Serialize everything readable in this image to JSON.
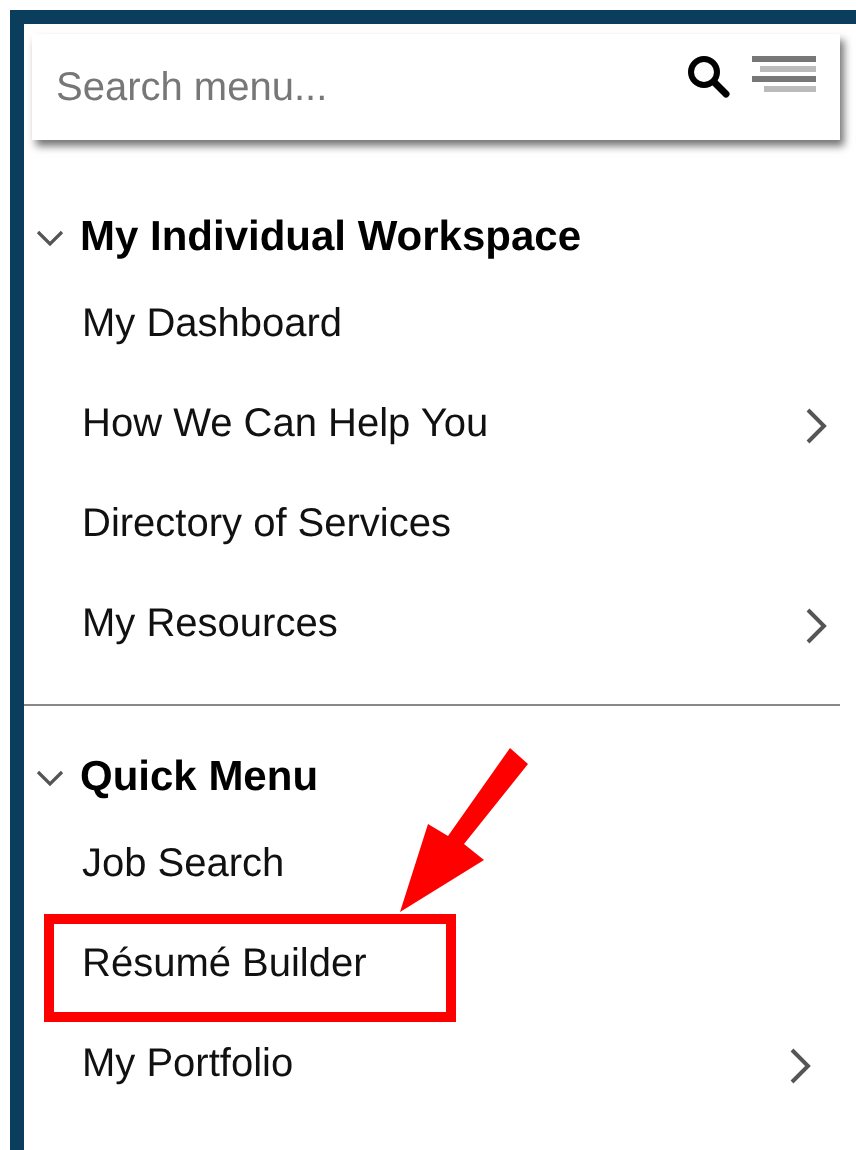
{
  "search": {
    "placeholder": "Search menu..."
  },
  "sections": [
    {
      "title": "My Individual Workspace",
      "expanded": true,
      "items": [
        {
          "label": "My Dashboard",
          "has_submenu": false,
          "highlighted": false
        },
        {
          "label": "How We Can Help You",
          "has_submenu": true,
          "highlighted": false
        },
        {
          "label": "Directory of Services",
          "has_submenu": false,
          "highlighted": false
        },
        {
          "label": "My Resources",
          "has_submenu": true,
          "highlighted": false
        }
      ]
    },
    {
      "title": "Quick Menu",
      "expanded": true,
      "items": [
        {
          "label": "Job Search",
          "has_submenu": false,
          "highlighted": false
        },
        {
          "label": "Résumé Builder",
          "has_submenu": false,
          "highlighted": true
        },
        {
          "label": "My Portfolio",
          "has_submenu": true,
          "highlighted": false
        }
      ]
    }
  ]
}
